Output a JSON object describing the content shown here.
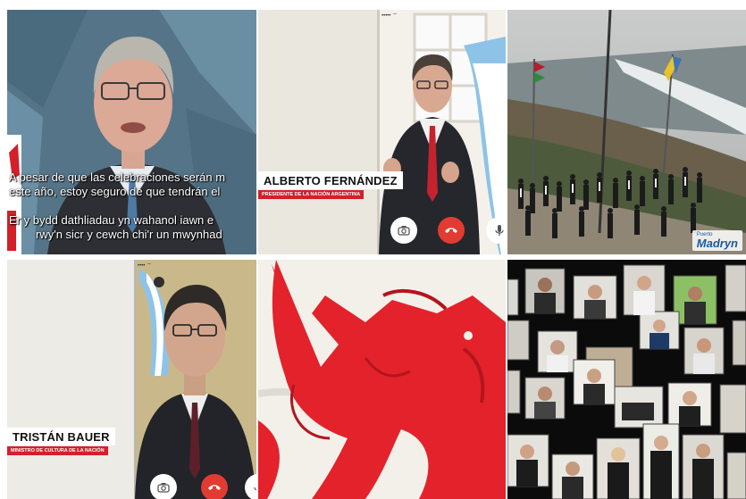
{
  "tiles": {
    "top_left": {
      "subtitle_es_line1": "A pesar de que las celebraciones serán m",
      "subtitle_es_line2": "este año, estoy seguro de que tendrán el",
      "subtitle_cy_line1": "Er y bydd dathliadau yn wahanol iawn e",
      "subtitle_cy_line2": "rwy'n sicr y cewch chi'r un mwynhad"
    },
    "top_middle": {
      "name": "ALBERTO FERNÁNDEZ",
      "role": "PRESIDENTE DE LA NACIÓN ARGENTINA",
      "status": "••••• ⌔"
    },
    "top_right": {
      "logo_small": "Puerto",
      "logo_big": "Madryn"
    },
    "bottom_left": {
      "name": "TRISTÁN BAUER",
      "role": "MINISTRO DE CULTURA DE LA NACIÓN",
      "status": "•••• ⌔"
    }
  },
  "colors": {
    "accent_red": "#d3202a",
    "end_call_red": "#e23b32",
    "argentina_blue": "#8ec3e8",
    "wales_dragon_red": "#e0202a"
  },
  "icons": [
    "camera-icon",
    "end-call-icon",
    "microphone-icon"
  ]
}
